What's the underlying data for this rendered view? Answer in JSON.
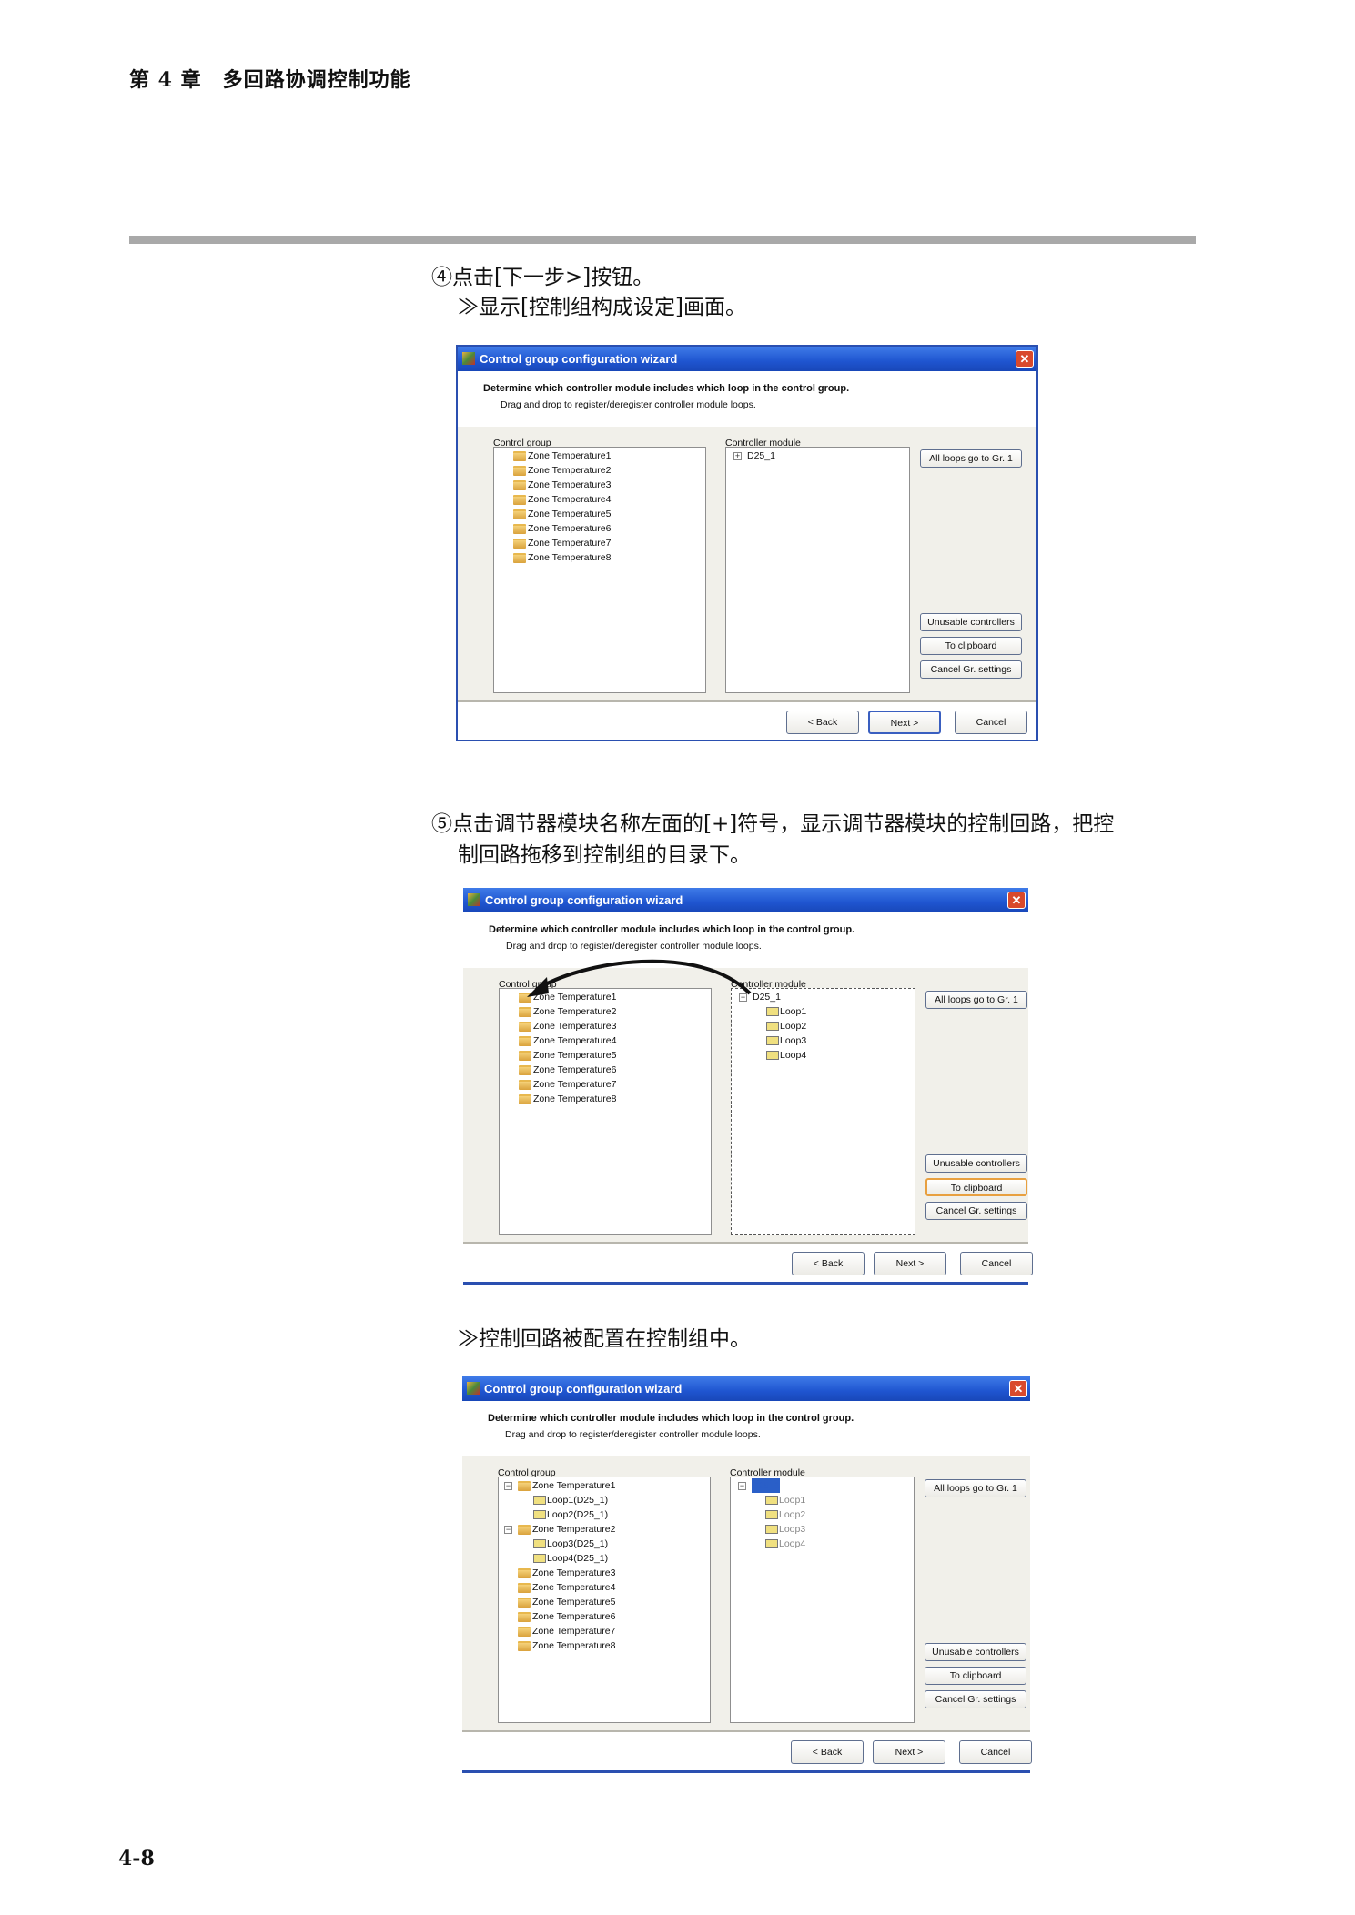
{
  "chapter_header": "第 4 章　多回路协调控制功能",
  "step4": {
    "line1": "④点击[下一步>]按钮。",
    "line2": "≫显示[控制组构成设定]画面。"
  },
  "step5": {
    "line1": "⑤点击调节器模块名称左面的[+]符号，显示调节器模块的控制回路，把控",
    "line2": "制回路拖移到控制组的目录下。"
  },
  "result_text": "≫控制回路被配置在控制组中。",
  "page_number": "4-8",
  "colors": {
    "titlebar": "#2a5fd0",
    "close": "#d9492c",
    "dialog_bg": "#f1f0ea",
    "selection": "#2a5fc8"
  },
  "dialogs": [
    {
      "title": "Control group configuration wizard",
      "heading": "Determine which controller module includes which loop in the control group.",
      "subheading": "Drag and drop to register/deregister controller module loops.",
      "group_label": "Control group",
      "module_label": "Controller module",
      "buttons": {
        "all_loops": "All loops go to Gr. 1",
        "unusable": "Unusable controllers",
        "clipboard": "To clipboard",
        "cancel_gr": "Cancel Gr. settings",
        "back": "< Back",
        "next": "Next >",
        "cancel": "Cancel"
      },
      "group_tree": [
        {
          "label": "Zone Temperature1",
          "icon": "folder",
          "level": 1
        },
        {
          "label": "Zone Temperature2",
          "icon": "folder",
          "level": 1
        },
        {
          "label": "Zone Temperature3",
          "icon": "folder",
          "level": 1
        },
        {
          "label": "Zone Temperature4",
          "icon": "folder",
          "level": 1
        },
        {
          "label": "Zone Temperature5",
          "icon": "folder",
          "level": 1
        },
        {
          "label": "Zone Temperature6",
          "icon": "folder",
          "level": 1
        },
        {
          "label": "Zone Temperature7",
          "icon": "folder",
          "level": 1
        },
        {
          "label": "Zone Temperature8",
          "icon": "folder",
          "level": 1
        }
      ],
      "module_tree": [
        {
          "label": "D25_1",
          "icon": "controller",
          "level": 0,
          "expander": "+"
        }
      ],
      "focused": "next",
      "module_focus": false,
      "clipboard_hot": false,
      "drag_arrow": false,
      "bordered": true
    },
    {
      "title": "Control group configuration wizard",
      "heading": "Determine which controller module includes which loop in the control group.",
      "subheading": "Drag and drop to register/deregister controller module loops.",
      "group_label": "Control group",
      "module_label": "Controller module",
      "buttons": {
        "all_loops": "All loops go to Gr. 1",
        "unusable": "Unusable controllers",
        "clipboard": "To clipboard",
        "cancel_gr": "Cancel Gr. settings",
        "back": "< Back",
        "next": "Next >",
        "cancel": "Cancel"
      },
      "group_tree": [
        {
          "label": "Zone Temperature1",
          "icon": "folder",
          "level": 1
        },
        {
          "label": "Zone Temperature2",
          "icon": "folder",
          "level": 1
        },
        {
          "label": "Zone Temperature3",
          "icon": "folder",
          "level": 1
        },
        {
          "label": "Zone Temperature4",
          "icon": "folder",
          "level": 1
        },
        {
          "label": "Zone Temperature5",
          "icon": "folder",
          "level": 1
        },
        {
          "label": "Zone Temperature6",
          "icon": "folder",
          "level": 1
        },
        {
          "label": "Zone Temperature7",
          "icon": "folder",
          "level": 1
        },
        {
          "label": "Zone Temperature8",
          "icon": "folder",
          "level": 1
        }
      ],
      "module_tree": [
        {
          "label": "D25_1",
          "icon": "controller",
          "level": 0,
          "expander": "−"
        },
        {
          "label": "Loop1",
          "icon": "loop",
          "level": 2
        },
        {
          "label": "Loop2",
          "icon": "loop",
          "level": 2
        },
        {
          "label": "Loop3",
          "icon": "loop",
          "level": 2
        },
        {
          "label": "Loop4",
          "icon": "loop",
          "level": 2
        }
      ],
      "focused": "none",
      "module_focus": true,
      "clipboard_hot": true,
      "drag_arrow": true,
      "bordered": false
    },
    {
      "title": "Control group configuration wizard",
      "heading": "Determine which controller module includes which loop in the control group.",
      "subheading": "Drag and drop to register/deregister controller module loops.",
      "group_label": "Control group",
      "module_label": "Controller module",
      "buttons": {
        "all_loops": "All loops go to Gr. 1",
        "unusable": "Unusable controllers",
        "clipboard": "To clipboard",
        "cancel_gr": "Cancel Gr. settings",
        "back": "< Back",
        "next": "Next >",
        "cancel": "Cancel"
      },
      "group_tree": [
        {
          "label": "Zone Temperature1",
          "icon": "folder",
          "level": 1,
          "expander": "−"
        },
        {
          "label": "Loop1(D25_1)",
          "icon": "loop",
          "level": 2
        },
        {
          "label": "Loop2(D25_1)",
          "icon": "loop",
          "level": 2
        },
        {
          "label": "Zone Temperature2",
          "icon": "folder",
          "level": 1,
          "expander": "−"
        },
        {
          "label": "Loop3(D25_1)",
          "icon": "loop",
          "level": 2
        },
        {
          "label": "Loop4(D25_1)",
          "icon": "loop",
          "level": 2
        },
        {
          "label": "Zone Temperature3",
          "icon": "folder",
          "level": 1
        },
        {
          "label": "Zone Temperature4",
          "icon": "folder",
          "level": 1
        },
        {
          "label": "Zone Temperature5",
          "icon": "folder",
          "level": 1
        },
        {
          "label": "Zone Temperature6",
          "icon": "folder",
          "level": 1
        },
        {
          "label": "Zone Temperature7",
          "icon": "folder",
          "level": 1
        },
        {
          "label": "Zone Temperature8",
          "icon": "folder",
          "level": 1
        }
      ],
      "module_tree": [
        {
          "label": "D25_1",
          "icon": "controller",
          "level": 0,
          "expander": "−",
          "state": "sel"
        },
        {
          "label": "Loop1",
          "icon": "loop",
          "level": 2,
          "state": "dim"
        },
        {
          "label": "Loop2",
          "icon": "loop",
          "level": 2,
          "state": "dim"
        },
        {
          "label": "Loop3",
          "icon": "loop",
          "level": 2,
          "state": "dim"
        },
        {
          "label": "Loop4",
          "icon": "loop",
          "level": 2,
          "state": "dim"
        }
      ],
      "focused": "none",
      "module_focus": false,
      "clipboard_hot": false,
      "drag_arrow": false,
      "bordered": false
    }
  ]
}
